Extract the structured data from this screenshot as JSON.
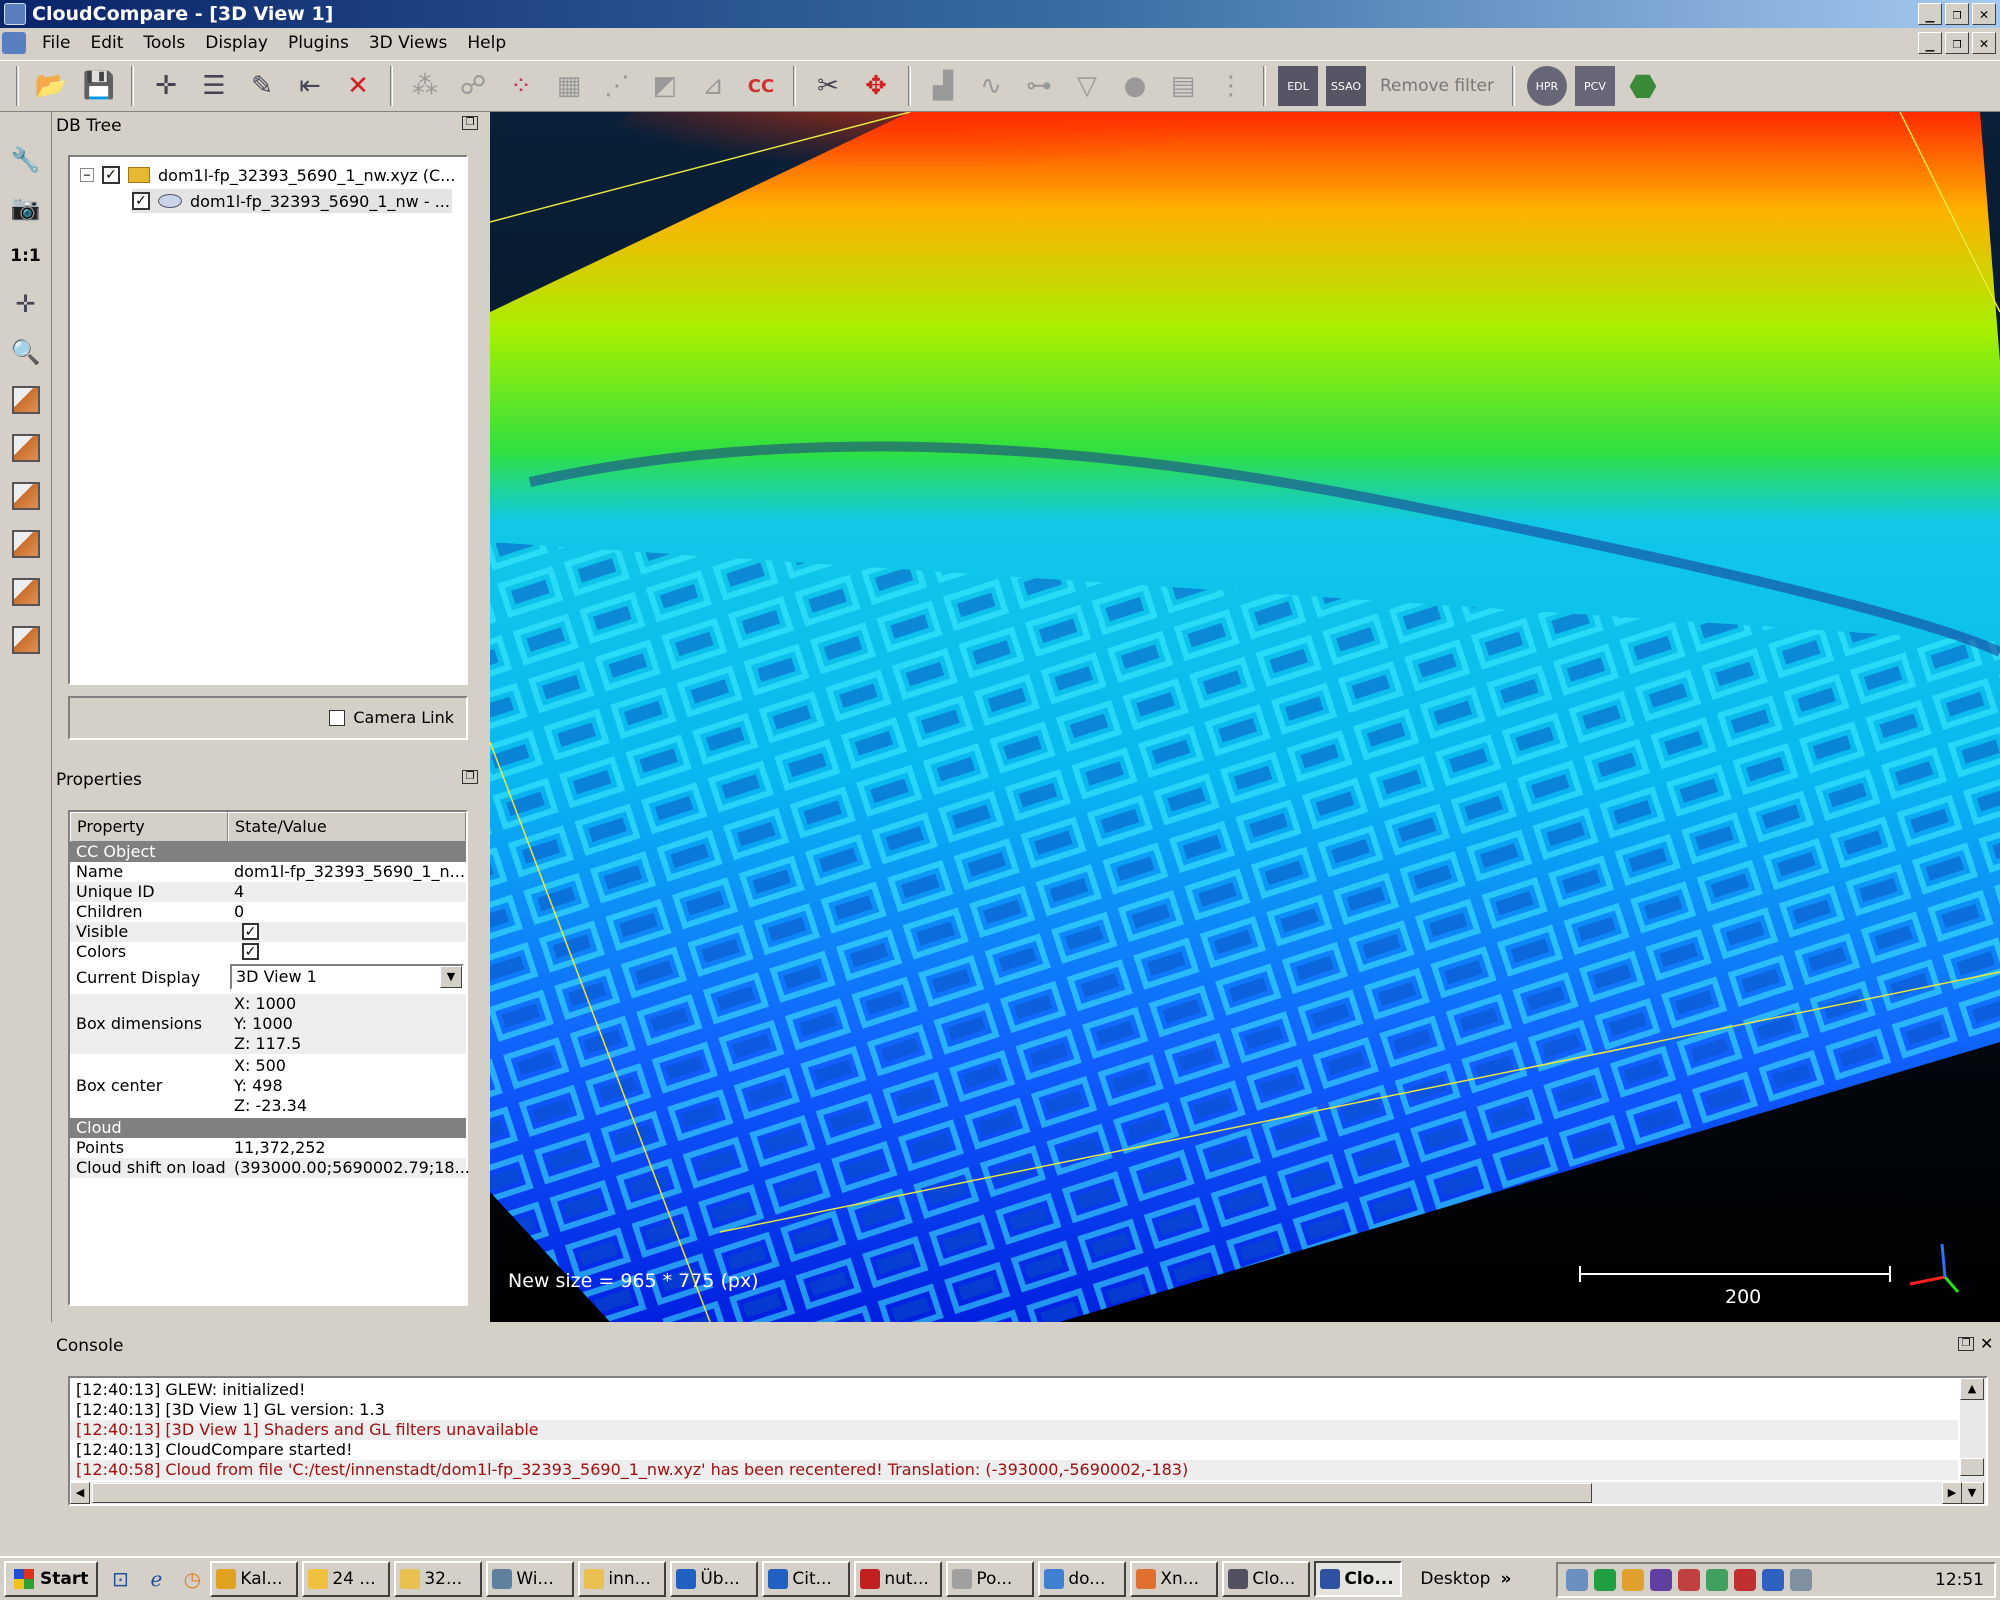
{
  "window": {
    "title": "CloudCompare - [3D View 1]"
  },
  "menu": [
    "File",
    "Edit",
    "Tools",
    "Display",
    "Plugins",
    "3D Views",
    "Help"
  ],
  "toolbar": {
    "remove_filter": "Remove filter"
  },
  "left_toolbar": {
    "one_to_one": "1:1"
  },
  "db_tree": {
    "title": "DB Tree",
    "items": [
      {
        "label": "dom1l-fp_32393_5690_1_nw.xyz (C...",
        "checked": true
      },
      {
        "label": "dom1l-fp_32393_5690_1_nw - ...",
        "checked": true
      }
    ],
    "camera_link": "Camera Link"
  },
  "properties": {
    "title": "Properties",
    "col_property": "Property",
    "col_value": "State/Value",
    "section_object": "CC Object",
    "name_label": "Name",
    "name_value": "dom1l-fp_32393_5690_1_n...",
    "uid_label": "Unique ID",
    "uid_value": "4",
    "children_label": "Children",
    "children_value": "0",
    "visible_label": "Visible",
    "colors_label": "Colors",
    "display_label": "Current Display",
    "display_value": "3D View 1",
    "boxdim_label": "Box dimensions",
    "boxdim_x": "X: 1000",
    "boxdim_y": "Y: 1000",
    "boxdim_z": "Z: 117.5",
    "boxcenter_label": "Box center",
    "boxcenter_x": "X: 500",
    "boxcenter_y": "Y: 498",
    "boxcenter_z": "Z: -23.34",
    "section_cloud": "Cloud",
    "points_label": "Points",
    "points_value": "11,372,252",
    "shift_label": "Cloud shift on load",
    "shift_value": "(393000.00;5690002.79;18..."
  },
  "view": {
    "new_size": "New size = 965 * 775 (px)",
    "scale_label": "200"
  },
  "console": {
    "title": "Console",
    "lines": [
      "[12:40:13] GLEW: initialized!",
      "[12:40:13] [3D View 1] GL version: 1.3",
      "[12:40:13] [3D View 1] Shaders and GL filters unavailable",
      "[12:40:13] CloudCompare started!",
      "[12:40:58] Cloud from file 'C:/test/innenstadt/dom1l-fp_32393_5690_1_nw.xyz' has been recentered! Translation: (-393000,-5690002,-183)"
    ]
  },
  "taskbar": {
    "start": "Start",
    "tasks": [
      "Kal...",
      "24 ...",
      "32...",
      "Wi...",
      "inn...",
      "Üb...",
      "Cit...",
      "nut...",
      "Po...",
      "do...",
      "Xn...",
      "Clo...",
      "Clo..."
    ],
    "desktop": "Desktop",
    "clock": "12:51"
  }
}
